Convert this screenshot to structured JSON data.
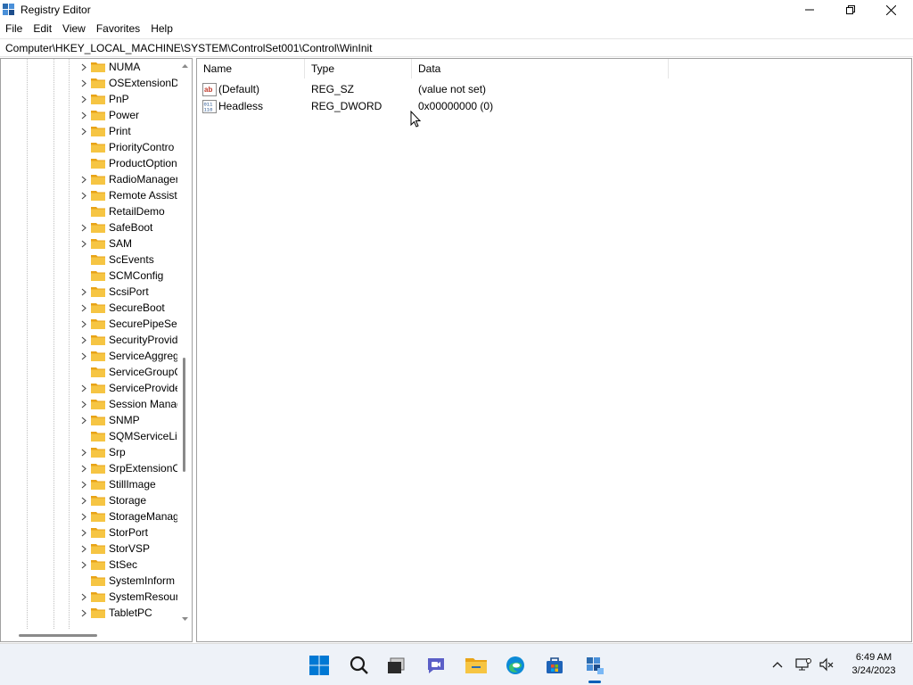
{
  "window": {
    "title": "Registry Editor",
    "minimize_glyph": "—",
    "maximize_glyph": "❐",
    "close_glyph": "✕"
  },
  "menu": [
    "File",
    "Edit",
    "View",
    "Favorites",
    "Help"
  ],
  "address": {
    "value": "Computer\\HKEY_LOCAL_MACHINE\\SYSTEM\\ControlSet001\\Control\\WinInit"
  },
  "tree": {
    "items": [
      {
        "label": "NUMA",
        "expandable": true
      },
      {
        "label": "OSExtensionD",
        "expandable": true
      },
      {
        "label": "PnP",
        "expandable": true
      },
      {
        "label": "Power",
        "expandable": true
      },
      {
        "label": "Print",
        "expandable": true
      },
      {
        "label": "PriorityContro",
        "expandable": false
      },
      {
        "label": "ProductOption",
        "expandable": false
      },
      {
        "label": "RadioManager",
        "expandable": true
      },
      {
        "label": "Remote Assist",
        "expandable": true
      },
      {
        "label": "RetailDemo",
        "expandable": false
      },
      {
        "label": "SafeBoot",
        "expandable": true
      },
      {
        "label": "SAM",
        "expandable": true
      },
      {
        "label": "ScEvents",
        "expandable": false
      },
      {
        "label": "SCMConfig",
        "expandable": false
      },
      {
        "label": "ScsiPort",
        "expandable": true
      },
      {
        "label": "SecureBoot",
        "expandable": true
      },
      {
        "label": "SecurePipeSer",
        "expandable": true
      },
      {
        "label": "SecurityProvid",
        "expandable": true
      },
      {
        "label": "ServiceAggreg",
        "expandable": true
      },
      {
        "label": "ServiceGroupO",
        "expandable": false
      },
      {
        "label": "ServiceProvide",
        "expandable": true
      },
      {
        "label": "Session Manag",
        "expandable": true
      },
      {
        "label": "SNMP",
        "expandable": true
      },
      {
        "label": "SQMServiceLis",
        "expandable": false
      },
      {
        "label": "Srp",
        "expandable": true
      },
      {
        "label": "SrpExtensionC",
        "expandable": true
      },
      {
        "label": "StillImage",
        "expandable": true
      },
      {
        "label": "Storage",
        "expandable": true
      },
      {
        "label": "StorageManag",
        "expandable": true
      },
      {
        "label": "StorPort",
        "expandable": true
      },
      {
        "label": "StorVSP",
        "expandable": true
      },
      {
        "label": "StSec",
        "expandable": true
      },
      {
        "label": "SystemInform",
        "expandable": false
      },
      {
        "label": "SystemResour",
        "expandable": true
      },
      {
        "label": "TabletPC",
        "expandable": true
      }
    ]
  },
  "list": {
    "columns": [
      "Name",
      "Type",
      "Data"
    ],
    "rows": [
      {
        "name": "(Default)",
        "type": "REG_SZ",
        "data": "(value not set)",
        "icon": "string-value-icon"
      },
      {
        "name": "Headless",
        "type": "REG_DWORD",
        "data": "0x00000000 (0)",
        "icon": "binary-value-icon"
      }
    ]
  },
  "taskbar": {
    "icons": [
      "start-icon",
      "search-icon",
      "task-view-icon",
      "chat-icon",
      "file-explorer-icon",
      "edge-icon",
      "store-icon",
      "registry-editor-icon"
    ],
    "time": "6:49 AM",
    "date": "3/24/2023"
  },
  "colors": {
    "accent": "#005fb8",
    "folder": "#f6c543",
    "border": "#a0a0a0"
  }
}
